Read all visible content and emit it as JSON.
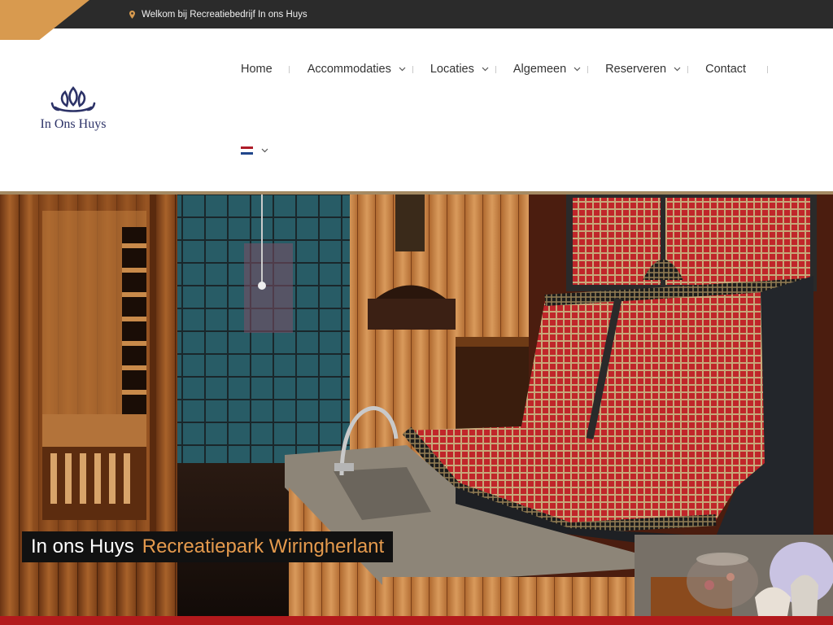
{
  "topbar": {
    "welcome_text": "Welkom bij Recreatiebedrijf In ons Huys",
    "pin_icon": "map-pin-icon",
    "accent_color": "#d89a4f"
  },
  "logo": {
    "text": "In Ons Huys",
    "color": "#2c3267"
  },
  "nav": {
    "items": [
      {
        "label": "Home",
        "dropdown": false
      },
      {
        "label": "Accommodaties",
        "dropdown": true
      },
      {
        "label": "Locaties",
        "dropdown": true
      },
      {
        "label": "Algemeen",
        "dropdown": true
      },
      {
        "label": "Reserveren",
        "dropdown": true
      },
      {
        "label": "Contact",
        "dropdown": false
      }
    ],
    "language": {
      "flag": "nl-flag-icon",
      "dropdown": true
    }
  },
  "hero": {
    "caption_part1": "In ons Huys",
    "caption_part2": "Recreatiepark Wiringherlant",
    "caption_accent_color": "#e59a4d",
    "bottom_bar_color": "#b3191c"
  }
}
